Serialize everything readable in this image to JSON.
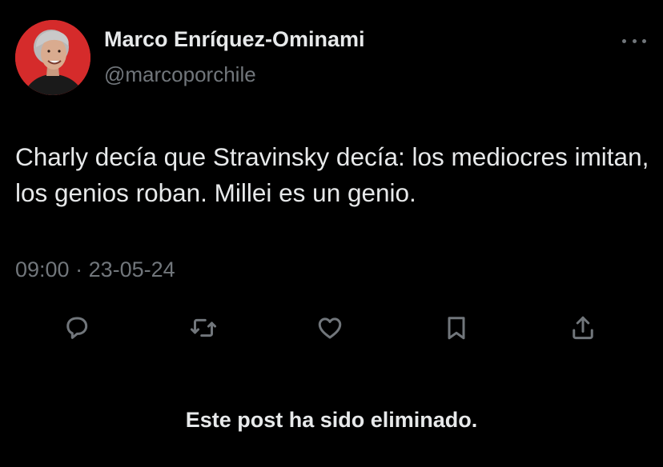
{
  "author": {
    "display_name": "Marco Enríquez-Ominami",
    "handle": "@marcoporchile",
    "avatar_bg": "#d52b2b"
  },
  "menu": {
    "icon": "more-horizontal-icon"
  },
  "post": {
    "text": "Charly decía que Stravinsky decía: los mediocres imitan, los genios roban. Millei es un genio.",
    "time": "09:00",
    "separator": "·",
    "date": "23-05-24"
  },
  "actions": [
    {
      "icon": "reply-icon"
    },
    {
      "icon": "repost-icon"
    },
    {
      "icon": "like-icon"
    },
    {
      "icon": "bookmark-icon"
    },
    {
      "icon": "share-icon"
    }
  ],
  "notice": "Este post ha sido eliminado.",
  "colors": {
    "background": "#000000",
    "primary_text": "#e7e9ea",
    "secondary_text": "#71767b"
  }
}
